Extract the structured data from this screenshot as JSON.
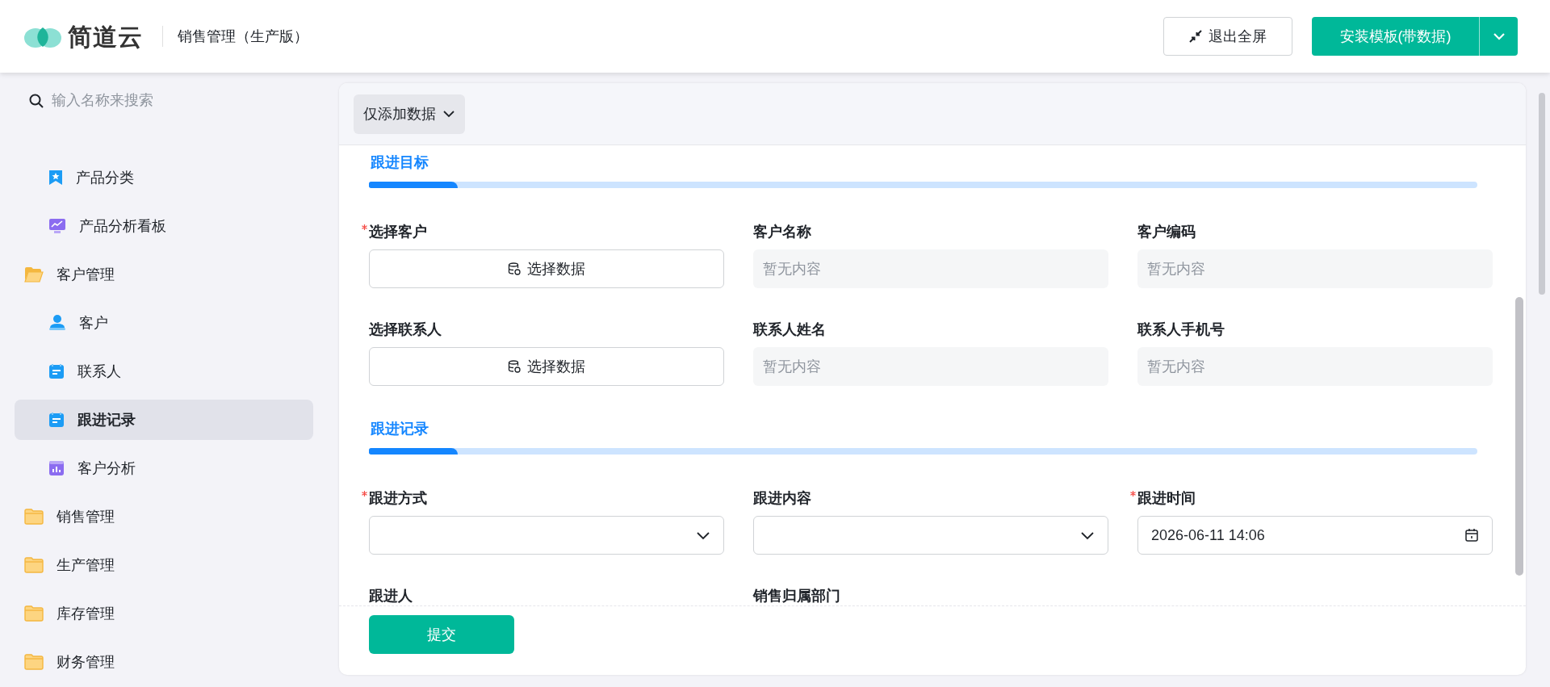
{
  "header": {
    "brand": "简道云",
    "app_title": "销售管理（生产版）",
    "exit_button": "退出全屏",
    "install_button": "安装模板(带数据)"
  },
  "sidebar": {
    "search": {
      "placeholder": "输入名称来搜索"
    },
    "items": [
      {
        "label": "产品分类",
        "kind": "bookmark",
        "selected": false
      },
      {
        "label": "产品分析看板",
        "kind": "trend",
        "selected": false
      },
      {
        "label": "客户管理",
        "kind": "folder",
        "expanded": true,
        "selected": false
      },
      {
        "label": "客户",
        "kind": "person",
        "selected": false
      },
      {
        "label": "联系人",
        "kind": "form",
        "selected": false
      },
      {
        "label": "跟进记录",
        "kind": "form",
        "selected": true
      },
      {
        "label": "客户分析",
        "kind": "stats",
        "selected": false
      },
      {
        "label": "销售管理",
        "kind": "folder",
        "expanded": false,
        "selected": false
      },
      {
        "label": "生产管理",
        "kind": "folder",
        "expanded": false,
        "selected": false
      },
      {
        "label": "库存管理",
        "kind": "folder",
        "expanded": false,
        "selected": false
      },
      {
        "label": "财务管理",
        "kind": "folder",
        "expanded": false,
        "selected": false
      }
    ]
  },
  "toolbar": {
    "mode_dropdown": "仅添加数据"
  },
  "form": {
    "sections": [
      {
        "title": "跟进目标",
        "fields": [
          {
            "label": "选择客户",
            "kind": "picker",
            "required": true,
            "text": "选择数据"
          },
          {
            "label": "客户名称",
            "kind": "readonly",
            "required": false,
            "placeholder": "暂无内容"
          },
          {
            "label": "客户编码",
            "kind": "readonly",
            "required": false,
            "placeholder": "暂无内容"
          },
          {
            "label": "选择联系人",
            "kind": "picker",
            "required": false,
            "text": "选择数据"
          },
          {
            "label": "联系人姓名",
            "kind": "readonly",
            "required": false,
            "placeholder": "暂无内容"
          },
          {
            "label": "联系人手机号",
            "kind": "readonly",
            "required": false,
            "placeholder": "暂无内容"
          }
        ]
      },
      {
        "title": "跟进记录",
        "fields": [
          {
            "label": "跟进方式",
            "kind": "select",
            "required": true
          },
          {
            "label": "跟进内容",
            "kind": "select",
            "required": false
          },
          {
            "label": "跟进时间",
            "kind": "datetime",
            "required": true,
            "value": "2026-06-11 14:06"
          },
          {
            "label": "跟进人",
            "kind": "cut",
            "required": false
          },
          {
            "label": "销售归属部门",
            "kind": "cut",
            "required": false
          }
        ]
      }
    ],
    "submit_button": "提交"
  }
}
